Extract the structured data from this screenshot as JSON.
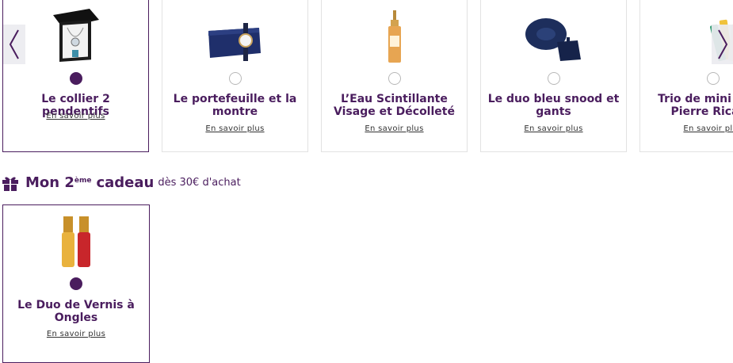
{
  "carousel": {
    "products": [
      {
        "title": "Le collier 2 pendentifs",
        "more": "En savoir plus",
        "selected": true,
        "icon": "necklace-box-image"
      },
      {
        "title": "Le portefeuille et la montre",
        "more": "En savoir plus",
        "selected": false,
        "icon": "wallet-watch-image"
      },
      {
        "title": "L’Eau Scintillante Visage et Décolleté",
        "more": "En savoir plus",
        "selected": false,
        "icon": "serum-bottle-image"
      },
      {
        "title": "Le duo bleu snood et gants",
        "more": "En savoir plus",
        "selected": false,
        "icon": "snood-gloves-image"
      },
      {
        "title": "Trio de mini soins Pierre Ricaud",
        "more": "En savoir plus",
        "selected": false,
        "icon": "mini-tubes-image"
      }
    ],
    "prev_icon": "chevron-left-icon",
    "next_icon": "chevron-right-icon"
  },
  "section": {
    "title_prefix": "Mon 2",
    "title_sup": "ème",
    "title_bold": "cadeau",
    "title_suffix": "dès 30€ d'achat",
    "icon": "gift-icon"
  },
  "gift_product": {
    "title": "Le Duo de Vernis à Ongles",
    "more": "En savoir plus",
    "selected": true,
    "icon": "nail-polish-duo-image"
  },
  "colors": {
    "accent": "#4a1d5e",
    "border": "#e2e2e2"
  }
}
